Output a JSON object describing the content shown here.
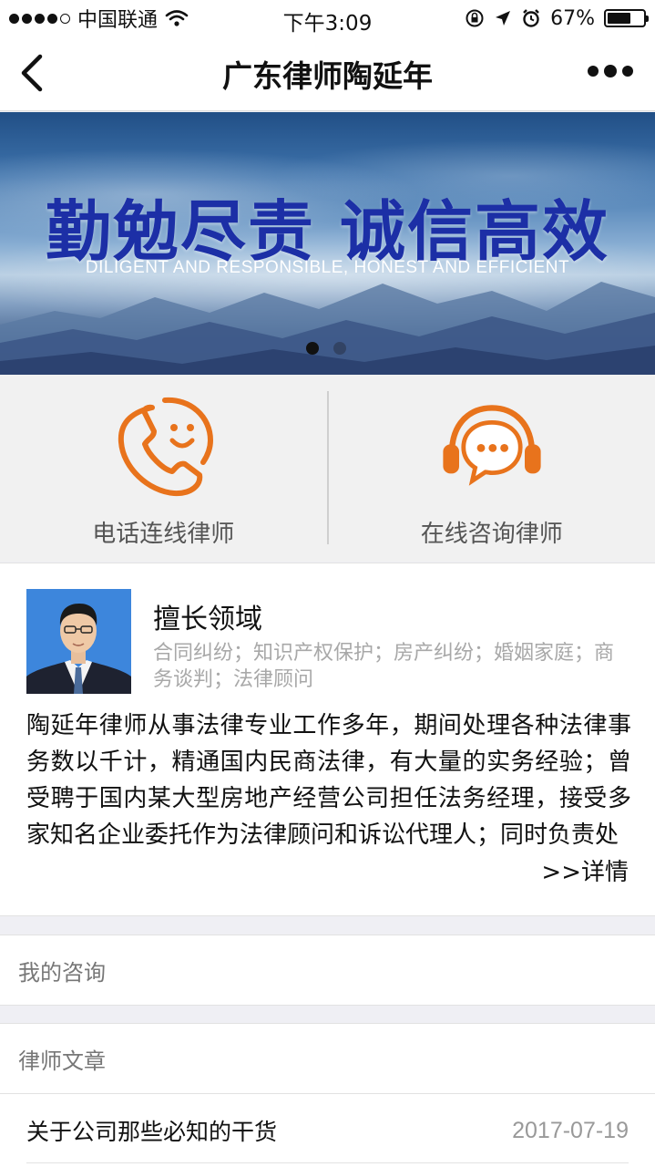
{
  "status_bar": {
    "carrier": "中国联通",
    "time": "下午3:09",
    "battery": "67%",
    "battery_level": 0.67
  },
  "nav": {
    "title": "广东律师陶延年"
  },
  "banner": {
    "slogan": "勤勉尽责 诚信高效",
    "subtitle": "DILIGENT AND RESPONSIBLE, HONEST AND EFFICIENT",
    "slide_count": 2,
    "active_slide": 1
  },
  "services": {
    "phone_label": "电话连线律师",
    "online_label": "在线咨询律师",
    "accent_color": "#e8731c"
  },
  "profile": {
    "expertise_title": "擅长领域",
    "expertise_text": "合同纠纷；知识产权保护；房产纠纷；婚姻家庭；商务谈判；法律顾问",
    "bio": "陶延年律师从事法律专业工作多年，期间处理各种法律事务数以千计，精通国内民商法律，有大量的实务经验；曾受聘于国内某大型房地产经营公司担任法务经理，接受多家知名企业委托作为法律顾问和诉讼代理人；同时负责处",
    "detail_link": ">>详情"
  },
  "menu": {
    "consultations": "我的咨询",
    "articles": "律师文章"
  },
  "articles": [
    {
      "title": "关于公司那些必知的干货",
      "date": "2017-07-19"
    }
  ]
}
